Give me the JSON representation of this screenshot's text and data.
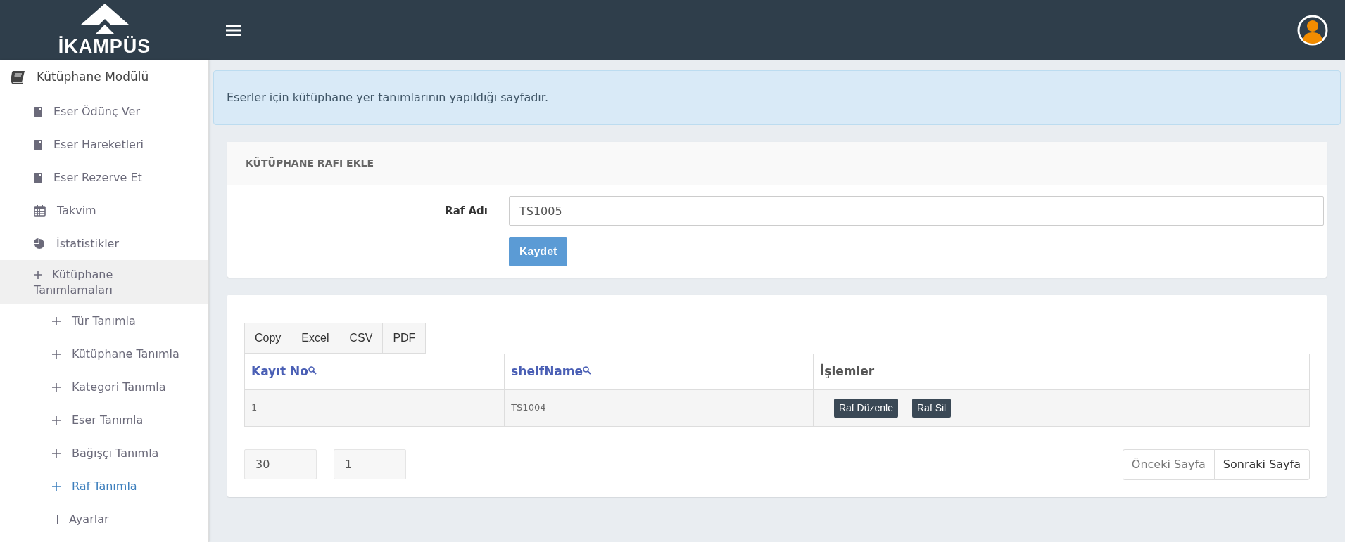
{
  "brand": {
    "name": "İKAMPÜS"
  },
  "sidebar": {
    "module": {
      "label": "Kütüphane Modülü"
    },
    "items": [
      {
        "kind": "book",
        "label": "Eser Ödünç Ver",
        "selected": false
      },
      {
        "kind": "book",
        "label": "Eser Hareketleri",
        "selected": false
      },
      {
        "kind": "book",
        "label": "Eser Rezerve Et",
        "selected": false
      },
      {
        "kind": "calendar",
        "label": "Takvim",
        "selected": false
      },
      {
        "kind": "pie",
        "label": "İstatistikler",
        "selected": false
      },
      {
        "kind": "plus",
        "label": "Kütüphane Tanımlamaları",
        "selected": false,
        "expanded": true,
        "children": [
          {
            "label": "Tür Tanımla",
            "selected": false
          },
          {
            "label": "Kütüphane Tanımla",
            "selected": false
          },
          {
            "label": "Kategori Tanımla",
            "selected": false
          },
          {
            "label": "Eser Tanımla",
            "selected": false
          },
          {
            "label": "Bağışçı Tanımla",
            "selected": false
          },
          {
            "label": "Raf Tanımla",
            "selected": true
          }
        ]
      },
      {
        "kind": "square",
        "label": "Ayarlar",
        "selected": false
      }
    ]
  },
  "alert": {
    "text": "Eserler için kütüphane yer tanımlarının yapıldığı sayfadır."
  },
  "form_card": {
    "title": "KÜTÜPHANE RAFI EKLE",
    "fields": [
      {
        "label": "Raf Adı",
        "value": "TS1005"
      }
    ],
    "submit": "Kaydet"
  },
  "table_card": {
    "export_buttons": [
      "Copy",
      "Excel",
      "CSV",
      "PDF"
    ],
    "columns": [
      {
        "label": "Kayıt No",
        "searchable": true
      },
      {
        "label": "shelfName",
        "searchable": true
      },
      {
        "label": "İşlemler",
        "searchable": false
      }
    ],
    "rows": [
      {
        "cells": [
          "1",
          "TS1004"
        ],
        "actions": [
          "Raf Düzenle",
          "Raf Sil"
        ]
      }
    ],
    "page_size": "30",
    "page_number": "1",
    "pager": [
      {
        "label": "Önceki Sayfa",
        "disabled": true
      },
      {
        "label": "Sonraki Sayfa",
        "disabled": false
      }
    ]
  }
}
